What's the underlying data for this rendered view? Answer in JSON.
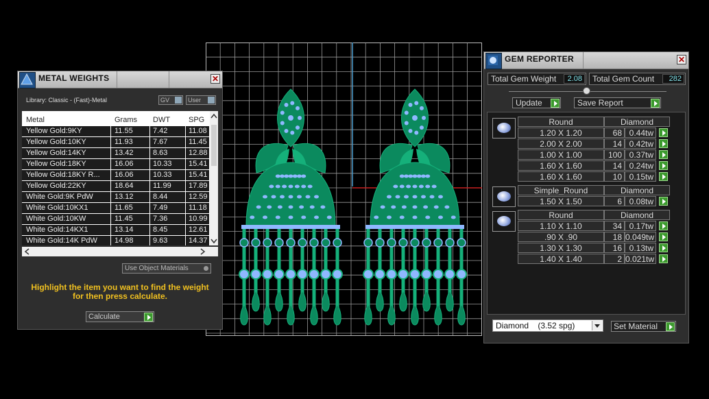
{
  "metal_panel": {
    "title": "METAL WEIGHTS",
    "library_label": "Library: Classic - (Fast)-Metal",
    "gv_label": "GV",
    "user_label": "User",
    "columns": [
      "Metal",
      "Grams",
      "DWT",
      "SPG"
    ],
    "rows": [
      {
        "metal": "Yellow Gold:9KY",
        "grams": "11.55",
        "dwt": "7.42",
        "spg": "11.08"
      },
      {
        "metal": "Yellow Gold:10KY",
        "grams": "11.93",
        "dwt": "7.67",
        "spg": "11.45"
      },
      {
        "metal": "Yellow Gold:14KY",
        "grams": "13.42",
        "dwt": "8.63",
        "spg": "12.88"
      },
      {
        "metal": "Yellow Gold:18KY",
        "grams": "16.06",
        "dwt": "10.33",
        "spg": "15.41"
      },
      {
        "metal": "Yellow Gold:18KY R...",
        "grams": "16.06",
        "dwt": "10.33",
        "spg": "15.41"
      },
      {
        "metal": "Yellow Gold:22KY",
        "grams": "18.64",
        "dwt": "11.99",
        "spg": "17.89"
      },
      {
        "metal": "White Gold:9K PdW",
        "grams": "13.12",
        "dwt": "8.44",
        "spg": "12.59"
      },
      {
        "metal": "White Gold:10KX1",
        "grams": "11.65",
        "dwt": "7.49",
        "spg": "11.18"
      },
      {
        "metal": "White Gold:10KW",
        "grams": "11.45",
        "dwt": "7.36",
        "spg": "10.99"
      },
      {
        "metal": "White Gold:14KX1",
        "grams": "13.14",
        "dwt": "8.45",
        "spg": "12.61"
      },
      {
        "metal": "White Gold:14K PdW",
        "grams": "14.98",
        "dwt": "9.63",
        "spg": "14.37"
      }
    ],
    "use_object_materials": "Use Object Materials",
    "hint": "Highlight the item you want to find the weight for then press calculate.",
    "calculate_label": "Calculate"
  },
  "gem_panel": {
    "title": "GEM REPORTER",
    "total_weight_label": "Total Gem Weight",
    "total_weight_value": "2.08",
    "total_count_label": "Total Gem Count",
    "total_count_value": "282",
    "update_label": "Update",
    "save_label": "Save Report",
    "groups": [
      {
        "shape": "Round",
        "material": "Diamond",
        "rows": [
          {
            "size": "1.20 X 1.20",
            "count": "68",
            "weight": "0.44tw"
          },
          {
            "size": "2.00 X 2.00",
            "count": "14",
            "weight": "0.42tw"
          },
          {
            "size": "1.00 X 1.00",
            "count": "100",
            "weight": "0.37tw"
          },
          {
            "size": "1.60 X 1.60",
            "count": "14",
            "weight": "0.24tw"
          },
          {
            "size": "1.60 X 1.60",
            "count": "10",
            "weight": "0.15tw"
          }
        ]
      },
      {
        "shape": "Simple_Round",
        "material": "Diamond",
        "rows": [
          {
            "size": "1.50 X 1.50",
            "count": "6",
            "weight": "0.08tw"
          }
        ]
      },
      {
        "shape": "Round",
        "material": "Diamond",
        "rows": [
          {
            "size": "1.10 X 1.10",
            "count": "34",
            "weight": "0.17tw"
          },
          {
            "size": ".90 X .90",
            "count": "18",
            "weight": "0.049tw"
          },
          {
            "size": "1.30 X 1.30",
            "count": "16",
            "weight": "0.13tw"
          },
          {
            "size": "1.40 X 1.40",
            "count": "2",
            "weight": "0.021tw"
          }
        ]
      }
    ],
    "material_select": "Diamond    (3.52 spg)",
    "set_material_label": "Set Material"
  },
  "colors": {
    "metal": "#0b8a5e",
    "metal_light": "#15b07a",
    "gem": "#8fb8ff",
    "grid": "#9a9a9a"
  }
}
